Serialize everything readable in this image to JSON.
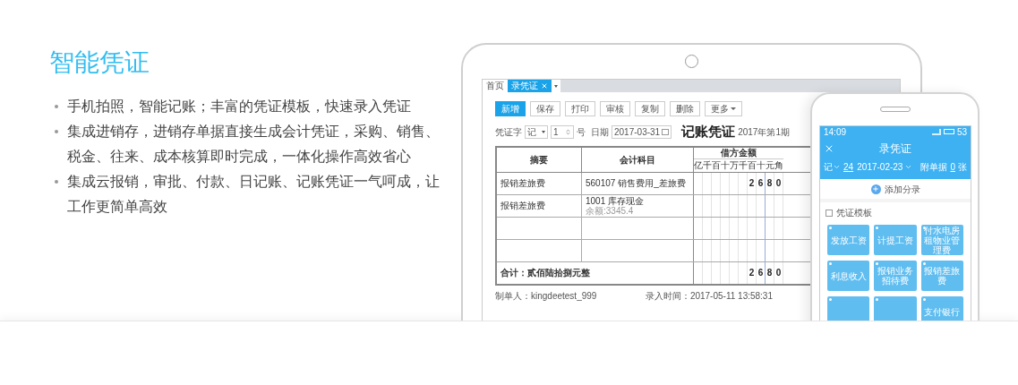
{
  "feature": {
    "title": "智能凭证",
    "bullets": [
      "手机拍照，智能记账；丰富的凭证模板，快速录入凭证",
      "集成进销存，进销存单据直接生成会计凭证，采购、销售、税金、往来、成本核算即时完成，一体化操作高效省心",
      "集成云报销，审批、付款、日记账、记账凭证一气呵成，让工作更简单高效"
    ]
  },
  "tablet": {
    "tabs": [
      {
        "label": "首页",
        "selected": false,
        "closable": false
      },
      {
        "label": "录凭证",
        "selected": true,
        "closable": true
      }
    ],
    "toolbar": [
      {
        "label": "新增",
        "kind": "primary"
      },
      {
        "label": "保存",
        "kind": "default"
      },
      {
        "label": "打印",
        "kind": "default"
      },
      {
        "label": "审核",
        "kind": "default"
      },
      {
        "label": "复制",
        "kind": "default"
      },
      {
        "label": "删除",
        "kind": "default"
      },
      {
        "label": "更多",
        "kind": "menu"
      }
    ],
    "voucher_word_label": "凭证字",
    "voucher_word": "记",
    "voucher_number": "1",
    "number_suffix": "号",
    "date_label": "日期",
    "date": "2017-03-31",
    "title": "记账凭证",
    "period": "2017年第1期",
    "columns": [
      "摘要",
      "会计科目",
      "借方金额"
    ],
    "digit_headers": [
      "亿",
      "千",
      "百",
      "十",
      "万",
      "千",
      "百",
      "十",
      "元",
      "角"
    ],
    "rows": [
      {
        "summary": "报销差旅费",
        "account": "560107 销售费用_差旅费",
        "balance": "",
        "amount": [
          "2",
          "6",
          "8",
          "0"
        ]
      },
      {
        "summary": "报销差旅费",
        "account": "1001 库存现金",
        "balance": "余额:3345.4",
        "amount": []
      },
      {
        "summary": "",
        "account": "",
        "balance": "",
        "amount": []
      },
      {
        "summary": "",
        "account": "",
        "balance": "",
        "amount": []
      }
    ],
    "total_label": "合计：贰佰陆拾捌元整",
    "total_amount": [
      "2",
      "6",
      "8",
      "0"
    ],
    "maker": "制单人：kingdeetest_999",
    "entry_time": "录入时间：2017-05-11 13:58:31"
  },
  "phone": {
    "time": "14:09",
    "battery": "53",
    "title": "录凭证",
    "voucher_word": "记",
    "voucher_number": "24",
    "date": "2017-02-23",
    "attachments_label": "附单据",
    "attachments": "0",
    "attachments_unit": "张",
    "add_entry": "添加分录",
    "templates_label": "凭证模板",
    "templates": [
      {
        "kind": "tile",
        "label": "发放工资"
      },
      {
        "kind": "tile",
        "label": "计提工资"
      },
      {
        "kind": "tile",
        "label": "付水电房租物业管理费"
      },
      {
        "kind": "tile",
        "label": "利息收入"
      },
      {
        "kind": "tile",
        "label": "报销业务招待费"
      },
      {
        "kind": "tile",
        "label": "报销差旅费"
      },
      {
        "kind": "tile"
      },
      {
        "kind": "tile"
      },
      {
        "kind": "tile",
        "label": "支付银行"
      }
    ]
  }
}
